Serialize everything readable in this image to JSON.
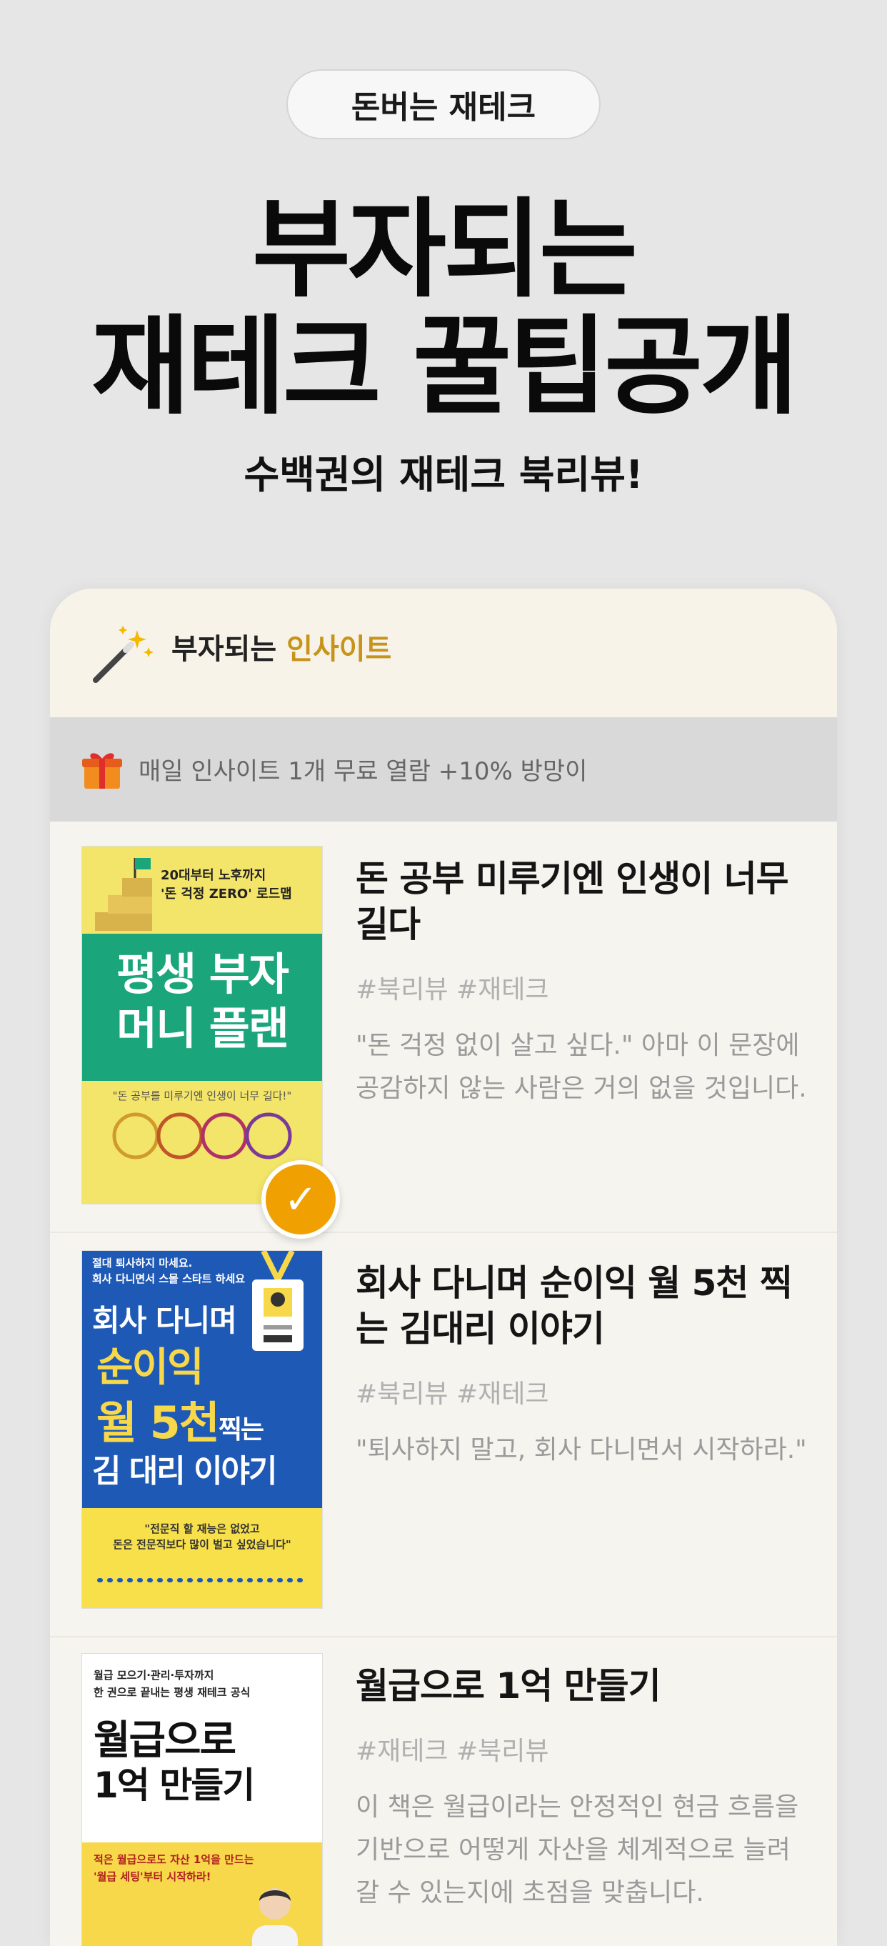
{
  "top_pill": "돈버는 재테크",
  "headline": {
    "line1": "부자되는",
    "line2": "재테크 꿀팁공개"
  },
  "subtitle": "수백권의 재테크 북리뷰!",
  "card": {
    "title_prefix": "부자되는 ",
    "title_accent": "인사이트",
    "banner_text": "매일 인사이트 1개 무료 열람 +10% 방망이",
    "accent_color": "#c8931a"
  },
  "books": [
    {
      "title": "돈 공부 미루기엔 인생이 너무 길다",
      "tags": "#북리뷰 #재테크",
      "desc": "\"돈 걱정 없이 살고 싶다.\" 아마 이 문장에 공감하지 않는 사람은 거의 없을 것입니다.",
      "checked": true,
      "cover": {
        "top": "20대부터 노후까지\n'돈 걱정 ZERO' 로드맵",
        "main1": "평생 부자",
        "main2": "머니 플랜",
        "quote": "\"돈 공부를 미루기엔 인생이 너무 길다!\""
      }
    },
    {
      "title": "회사 다니며 순이익 월 5천 찍는 김대리 이야기",
      "tags": "#북리뷰 #재테크",
      "desc": "\"퇴사하지 말고, 회사 다니면서 시작하라.\"",
      "checked": false,
      "cover": {
        "top": "절대 퇴사하지 마세요.\n회사 다니면서 스몰 스타트 하세요",
        "line1": "회사 다니며",
        "line2": "순이익",
        "line3": "월 5천",
        "line3b": "찍는",
        "line4": "김 대리 이야기",
        "quote": "\"전문직 할 재능은 없었고\n돈은 전문직보다 많이 벌고 싶었습니다\""
      }
    },
    {
      "title": "월급으로 1억 만들기",
      "tags": "#재테크 #북리뷰",
      "desc": "이 책은 월급이라는 안정적인 현금 흐름을 기반으로 어떻게 자산을 체계적으로 늘려갈 수 있는지에 초점을 맞춥니다.",
      "checked": false,
      "cover": {
        "top": "월급 모으기·관리·투자까지\n한 권으로 끝내는 평생 재테크 공식",
        "main1": "월급으로",
        "main2": "1억 만들기",
        "band": "적은 월급으로도 자산 1억을 만드는\n'월급 세팅'부터 시작하라!"
      }
    }
  ]
}
